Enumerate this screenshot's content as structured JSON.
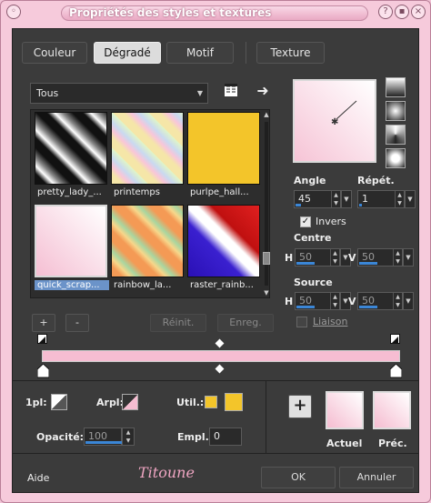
{
  "window": {
    "title": "Propriétés des styles et textures"
  },
  "tabs": [
    {
      "label": "Couleur",
      "active": false
    },
    {
      "label": "Dégradé",
      "active": true
    },
    {
      "label": "Motif",
      "active": false
    },
    {
      "label": "Texture",
      "active": false
    }
  ],
  "category_select": {
    "value": "Tous"
  },
  "gallery": [
    {
      "name": "pretty_lady_...",
      "selected": false
    },
    {
      "name": "printemps",
      "selected": false
    },
    {
      "name": "purlpe_hall...",
      "selected": false
    },
    {
      "name": "quick_scrap...",
      "selected": true
    },
    {
      "name": "rainbow_la...",
      "selected": false
    },
    {
      "name": "raster_rainb...",
      "selected": false
    }
  ],
  "buttons": {
    "add": "+",
    "remove": "-",
    "reset": "Réinit.",
    "save": "Enreg.",
    "help": "Aide",
    "ok": "OK",
    "cancel": "Annuler",
    "add_color": "+"
  },
  "angle": {
    "label": "Angle",
    "value": "45",
    "fraction": 0.125
  },
  "repeat": {
    "label": "Répét.",
    "value": "1",
    "fraction": 0.02
  },
  "invert": {
    "label": "Invers",
    "checked": true
  },
  "center": {
    "label": "Centre",
    "h_label": "H",
    "h_value": "50",
    "v_label": "V",
    "v_value": "50"
  },
  "source": {
    "label": "Source",
    "h_label": "H",
    "h_value": "50",
    "v_label": "V",
    "v_value": "50"
  },
  "link": {
    "label": "Liaison",
    "checked": false
  },
  "gradient_editor": {
    "stops": [
      0,
      1
    ],
    "midpoint": 0.5,
    "start_color": "#f6bdd2",
    "end_color": "#f6bdd2"
  },
  "bottom": {
    "first_label": "1pl:",
    "arpl_label": "Arpl:",
    "util_label": "Util.:",
    "opacity_label": "Opacité:",
    "opacity_value": "100",
    "empl_label": "Empl.:",
    "empl_value": "0",
    "current_label": "Actuel",
    "previous_label": "Préc."
  },
  "signature": "Titoune",
  "colors": {
    "accent": "#3b86d6",
    "pink": "#f6bdd2",
    "yellow": "#f3c52a"
  }
}
